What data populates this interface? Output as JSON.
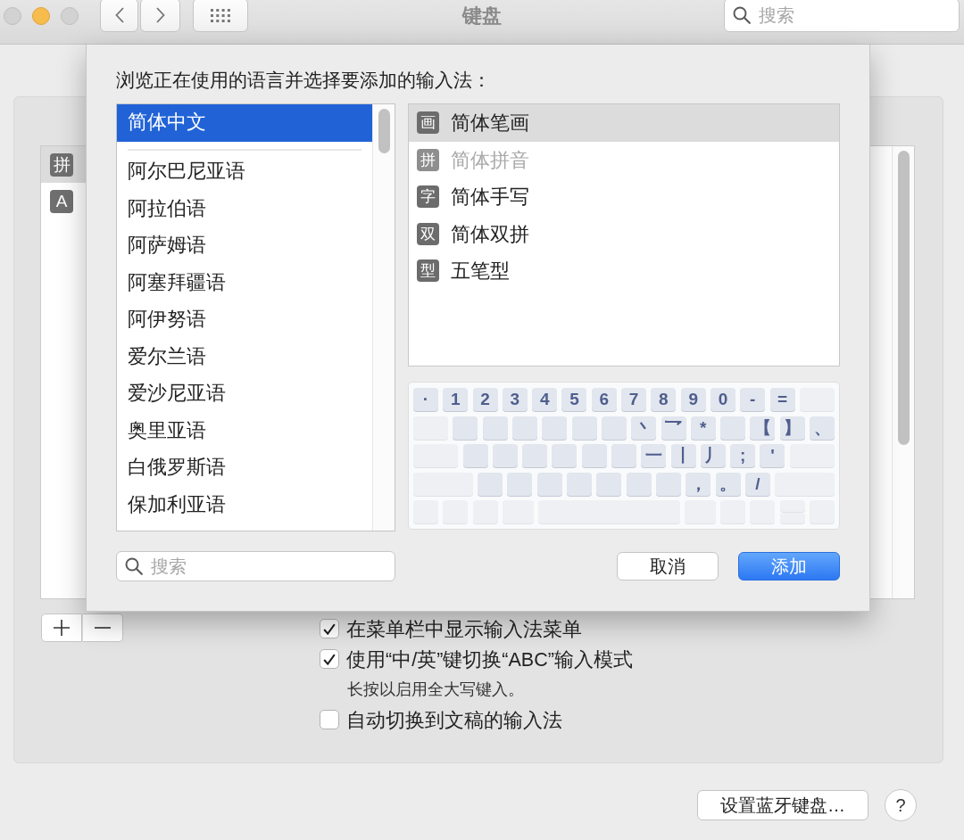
{
  "window": {
    "title": "键盘",
    "search": {
      "placeholder": "搜索"
    }
  },
  "traffic_lights": [
    {
      "kind": "close",
      "enabled": false
    },
    {
      "kind": "minimize",
      "enabled": true
    },
    {
      "kind": "zoom",
      "enabled": false
    }
  ],
  "input_sources": [
    {
      "badge": "拼",
      "selected": true
    },
    {
      "badge": "A",
      "selected": false
    }
  ],
  "sheet": {
    "heading": "浏览正在使用的语言并选择要添加的输入法：",
    "languages": {
      "preferred": [
        {
          "label": "简体中文",
          "selected": true
        }
      ],
      "others": [
        {
          "label": "阿尔巴尼亚语",
          "selected": false
        },
        {
          "label": "阿拉伯语",
          "selected": false
        },
        {
          "label": "阿萨姆语",
          "selected": false
        },
        {
          "label": "阿塞拜疆语",
          "selected": false
        },
        {
          "label": "阿伊努语",
          "selected": false
        },
        {
          "label": "爱尔兰语",
          "selected": false
        },
        {
          "label": "爱沙尼亚语",
          "selected": false
        },
        {
          "label": "奥里亚语",
          "selected": false
        },
        {
          "label": "白俄罗斯语",
          "selected": false
        },
        {
          "label": "保加利亚语",
          "selected": false
        }
      ]
    },
    "input_methods": [
      {
        "badge": "画",
        "label": "简体笔画",
        "selected": true,
        "disabled": false
      },
      {
        "badge": "拼",
        "label": "简体拼音",
        "selected": false,
        "disabled": true
      },
      {
        "badge": "字",
        "label": "简体手写",
        "selected": false,
        "disabled": false
      },
      {
        "badge": "双",
        "label": "简体双拼",
        "selected": false,
        "disabled": false
      },
      {
        "badge": "型",
        "label": "五笔型",
        "selected": false,
        "disabled": false
      }
    ],
    "keyboard": {
      "rows": [
        [
          {
            "kind": "key",
            "label": "·"
          },
          {
            "kind": "key",
            "label": "1"
          },
          {
            "kind": "key",
            "label": "2"
          },
          {
            "kind": "key",
            "label": "3"
          },
          {
            "kind": "key",
            "label": "4"
          },
          {
            "kind": "key",
            "label": "5"
          },
          {
            "kind": "key",
            "label": "6"
          },
          {
            "kind": "key",
            "label": "7"
          },
          {
            "kind": "key",
            "label": "8"
          },
          {
            "kind": "key",
            "label": "9"
          },
          {
            "kind": "key",
            "label": "0"
          },
          {
            "kind": "key",
            "label": "-"
          },
          {
            "kind": "key",
            "label": "="
          },
          {
            "kind": "wide"
          }
        ],
        [
          {
            "kind": "wide"
          },
          {
            "kind": "key"
          },
          {
            "kind": "key"
          },
          {
            "kind": "key"
          },
          {
            "kind": "key"
          },
          {
            "kind": "key"
          },
          {
            "kind": "key"
          },
          {
            "kind": "key",
            "label": "丶"
          },
          {
            "kind": "key",
            "label": "乛"
          },
          {
            "kind": "key",
            "label": "*"
          },
          {
            "kind": "key"
          },
          {
            "kind": "key",
            "label": "【"
          },
          {
            "kind": "key",
            "label": "】"
          },
          {
            "kind": "key",
            "label": "、"
          }
        ],
        [
          {
            "kind": "wide"
          },
          {
            "kind": "key"
          },
          {
            "kind": "key"
          },
          {
            "kind": "key"
          },
          {
            "kind": "key"
          },
          {
            "kind": "key"
          },
          {
            "kind": "key"
          },
          {
            "kind": "key",
            "label": "一"
          },
          {
            "kind": "key",
            "label": "丨"
          },
          {
            "kind": "key",
            "label": "丿"
          },
          {
            "kind": "key",
            "label": ";"
          },
          {
            "kind": "key",
            "label": "'"
          },
          {
            "kind": "wide"
          }
        ],
        [
          {
            "kind": "wide"
          },
          {
            "kind": "key"
          },
          {
            "kind": "key"
          },
          {
            "kind": "key"
          },
          {
            "kind": "key"
          },
          {
            "kind": "key"
          },
          {
            "kind": "key"
          },
          {
            "kind": "key"
          },
          {
            "kind": "key",
            "label": "，"
          },
          {
            "kind": "key",
            "label": "。"
          },
          {
            "kind": "key",
            "label": "/"
          },
          {
            "kind": "wide"
          }
        ],
        [
          {
            "kind": "mod"
          },
          {
            "kind": "mod"
          },
          {
            "kind": "mod"
          },
          {
            "kind": "cmd"
          },
          {
            "kind": "wide"
          },
          {
            "kind": "cmd"
          },
          {
            "kind": "mod"
          },
          {
            "kind": "mod"
          },
          {
            "kind": "updown"
          },
          {
            "kind": "mod"
          }
        ]
      ]
    },
    "search": {
      "placeholder": "搜索"
    },
    "buttons": [
      {
        "kind": "cancel",
        "label": "取消"
      },
      {
        "kind": "primary",
        "label": "添加"
      }
    ]
  },
  "options": [
    {
      "kind": "checkbox",
      "label": "在菜单栏中显示输入法菜单",
      "checked": true
    },
    {
      "kind": "checkbox",
      "label": "使用“中/英”键切换“ABC”输入模式",
      "checked": true
    },
    {
      "kind": "note",
      "label": "长按以启用全大写键入。"
    },
    {
      "kind": "checkbox",
      "label": "自动切换到文稿的输入法",
      "checked": false
    }
  ],
  "footer": {
    "bluetooth_button": "设置蓝牙键盘…",
    "help_button": "?"
  }
}
